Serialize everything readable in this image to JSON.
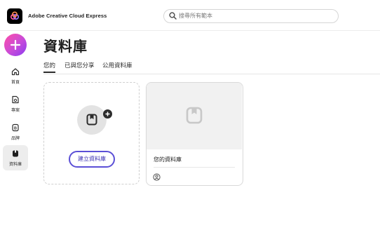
{
  "app": {
    "name": "Adobe Creative Cloud Express",
    "logo_icon": "creative-cloud-express-logo"
  },
  "search": {
    "placeholder": "搜尋所有範本",
    "value": "",
    "icon": "search-icon"
  },
  "sidebar": {
    "create_icon": "plus-icon",
    "items": [
      {
        "label": "首頁",
        "icon": "home-icon",
        "active": false
      },
      {
        "label": "專案",
        "icon": "projects-icon",
        "active": false
      },
      {
        "label": "品牌",
        "icon": "brand-icon",
        "active": false
      },
      {
        "label": "資料庫",
        "icon": "library-icon",
        "active": true
      }
    ]
  },
  "main": {
    "title": "資料庫",
    "tabs": [
      {
        "label": "您的",
        "active": true
      },
      {
        "label": "已與您分享",
        "active": false
      },
      {
        "label": "公用資料庫",
        "active": false
      }
    ],
    "new_card": {
      "button_label": "建立資料庫",
      "icon": "library-icon",
      "badge_icon": "plus-icon"
    },
    "library_card": {
      "name": "您的資料庫",
      "thumb_icon": "library-icon",
      "owner_icon": "user-icon"
    }
  },
  "colors": {
    "accent": "#5b4fd6",
    "create_gradient_start": "#ff4da6",
    "create_gradient_end": "#8a3df0",
    "active_nav_bg": "#ededed"
  }
}
